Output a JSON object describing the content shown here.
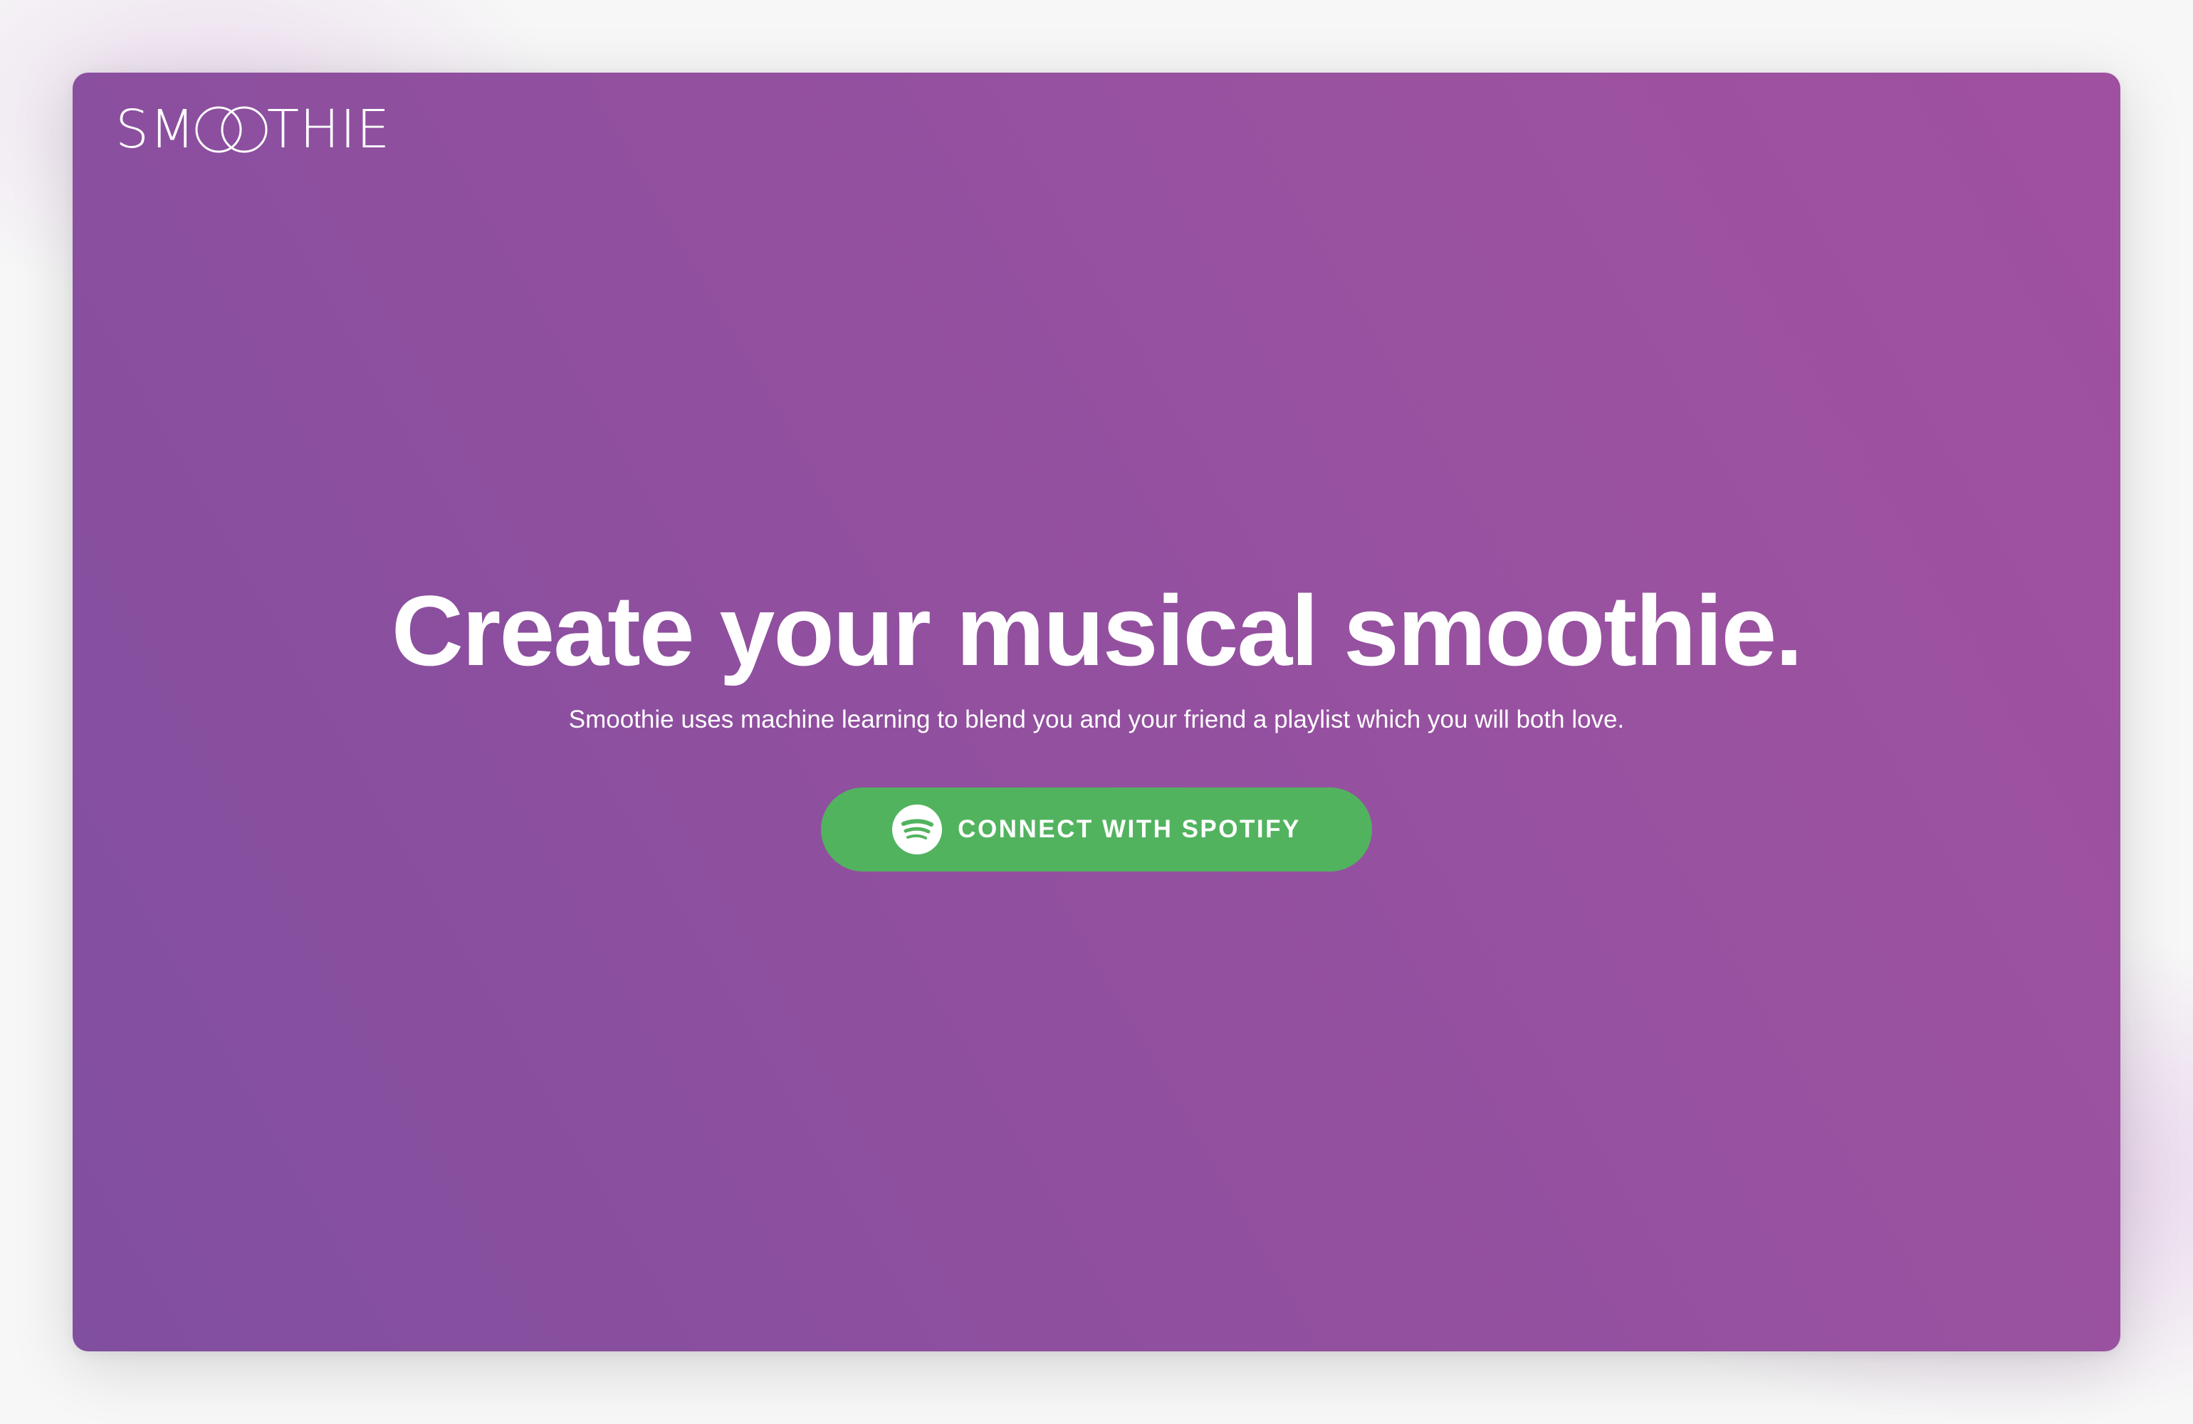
{
  "brand": {
    "logo_text_left": "SM",
    "logo_text_right": "THIE",
    "logo_rings": "OO"
  },
  "hero": {
    "headline": "Create your musical smoothie.",
    "subtitle": "Smoothie uses machine learning to blend you and your friend a playlist which you will both love.",
    "cta_label": "CONNECT WITH SPOTIFY",
    "cta_icon": "spotify-icon"
  },
  "colors": {
    "background_gradient_start": "#814f9f",
    "background_gradient_end": "#a050a0",
    "cta_green": "#52b35f",
    "text": "#ffffff"
  }
}
